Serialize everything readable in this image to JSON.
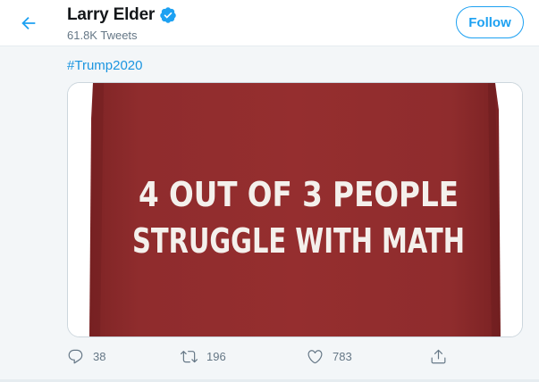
{
  "header": {
    "name": "Larry Elder",
    "tweet_count": "61.8K Tweets",
    "follow_label": "Follow"
  },
  "tweet": {
    "hashtag": "#Trump2020",
    "image_text": {
      "line1": "4 OUT OF 3 PEOPLE",
      "line2": "STRUGGLE WITH MATH"
    }
  },
  "actions": {
    "replies": "38",
    "retweets": "196",
    "likes": "783"
  },
  "colors": {
    "accent": "#1da1f2",
    "link": "#1b95e0",
    "secondary_text": "#657786",
    "shirt_red": "#8e2a2b"
  },
  "icons": {
    "back": "arrow-left-icon",
    "verified": "verified-badge-icon",
    "reply": "reply-icon",
    "retweet": "retweet-icon",
    "like": "heart-icon",
    "share": "share-icon"
  }
}
